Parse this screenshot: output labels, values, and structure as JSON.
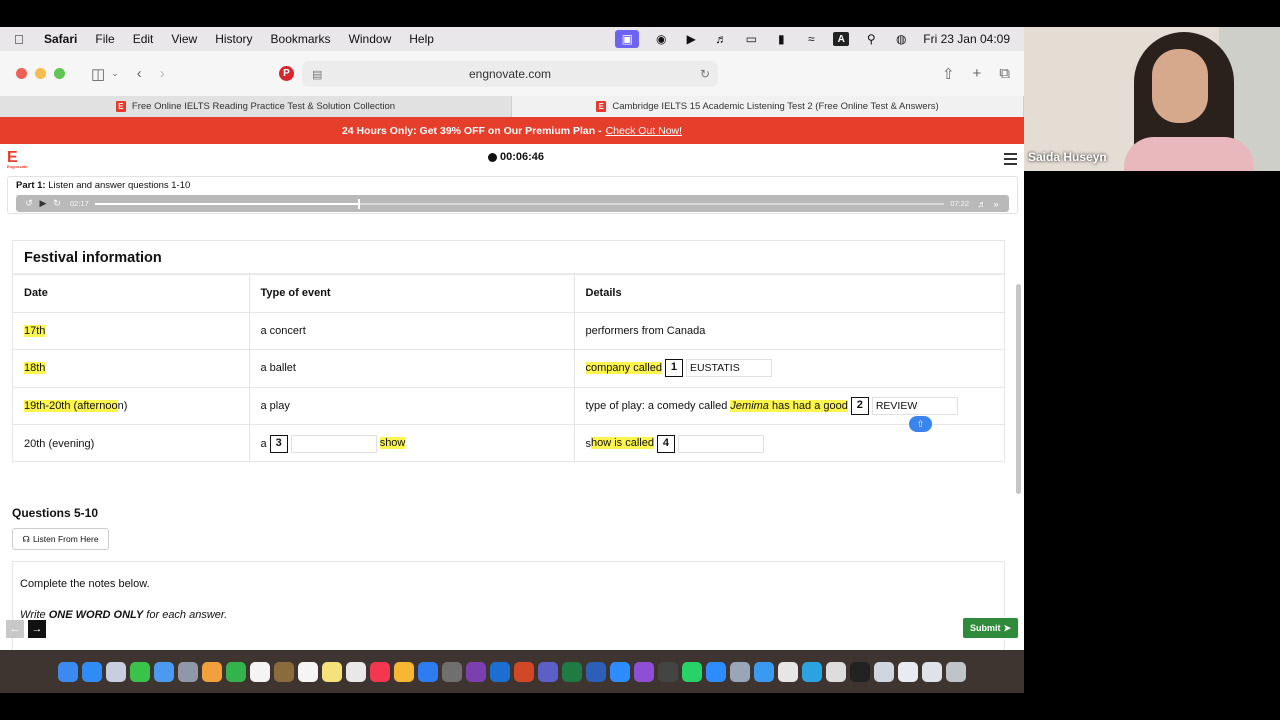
{
  "menubar": {
    "app": "Safari",
    "items": [
      "File",
      "Edit",
      "View",
      "History",
      "Bookmarks",
      "Window",
      "Help"
    ],
    "status_letter": "A",
    "clock": "Fri 23 Jan  04:09"
  },
  "browser": {
    "address": "engnovate.com",
    "tabs": [
      {
        "title": "Free Online IELTS Reading Practice Test & Solution Collection"
      },
      {
        "title": "Cambridge IELTS 15 Academic Listening Test 2 (Free Online Test & Answers)"
      }
    ]
  },
  "promo": {
    "text": "24 Hours Only: Get 39% OFF on Our Premium Plan - ",
    "link": "Check Out Now!"
  },
  "header": {
    "logo_letter": "E",
    "logo_sub": "Engnovate",
    "timer": "00:06:46"
  },
  "part": {
    "label": "Part 1:",
    "instruction": "Listen and answer questions 1-10",
    "player": {
      "elapsed": "02:17",
      "duration": "07:22",
      "progress": 0.31
    }
  },
  "festival": {
    "title": "Festival information",
    "headers": [
      "Date",
      "Type of event",
      "Details"
    ],
    "rows": [
      {
        "date": "17th",
        "event": "a concert",
        "details": "performers from Canada"
      },
      {
        "date": "18th",
        "event": "a ballet",
        "details_pre": "company called",
        "q": "1",
        "answer": "EUSTATIS"
      },
      {
        "date_hl": "19th-20th (afternoo",
        "date_rest": "n)",
        "event": "a play",
        "details_pre": "type of play: a comedy called ",
        "details_em": "Jemima",
        "details_post": " has had a good",
        "q": "2",
        "answer": "REVIEW"
      },
      {
        "date": "20th (evening)",
        "event_pre": "a",
        "event_q": "3",
        "event_post": "show",
        "details_pre_plain": "s",
        "details_pre": "how is called",
        "q": "4",
        "answer": ""
      }
    ]
  },
  "questions": {
    "heading": "Questions 5-10",
    "listen_label": "Listen From Here",
    "instruction1": "Complete the notes below.",
    "instruction2_pre": "Write ",
    "instruction2_bold": "ONE WORD ONLY",
    "instruction2_post": " for each answer."
  },
  "submit_label": "Submit",
  "webcam": {
    "name": "Saida Huseyn"
  }
}
